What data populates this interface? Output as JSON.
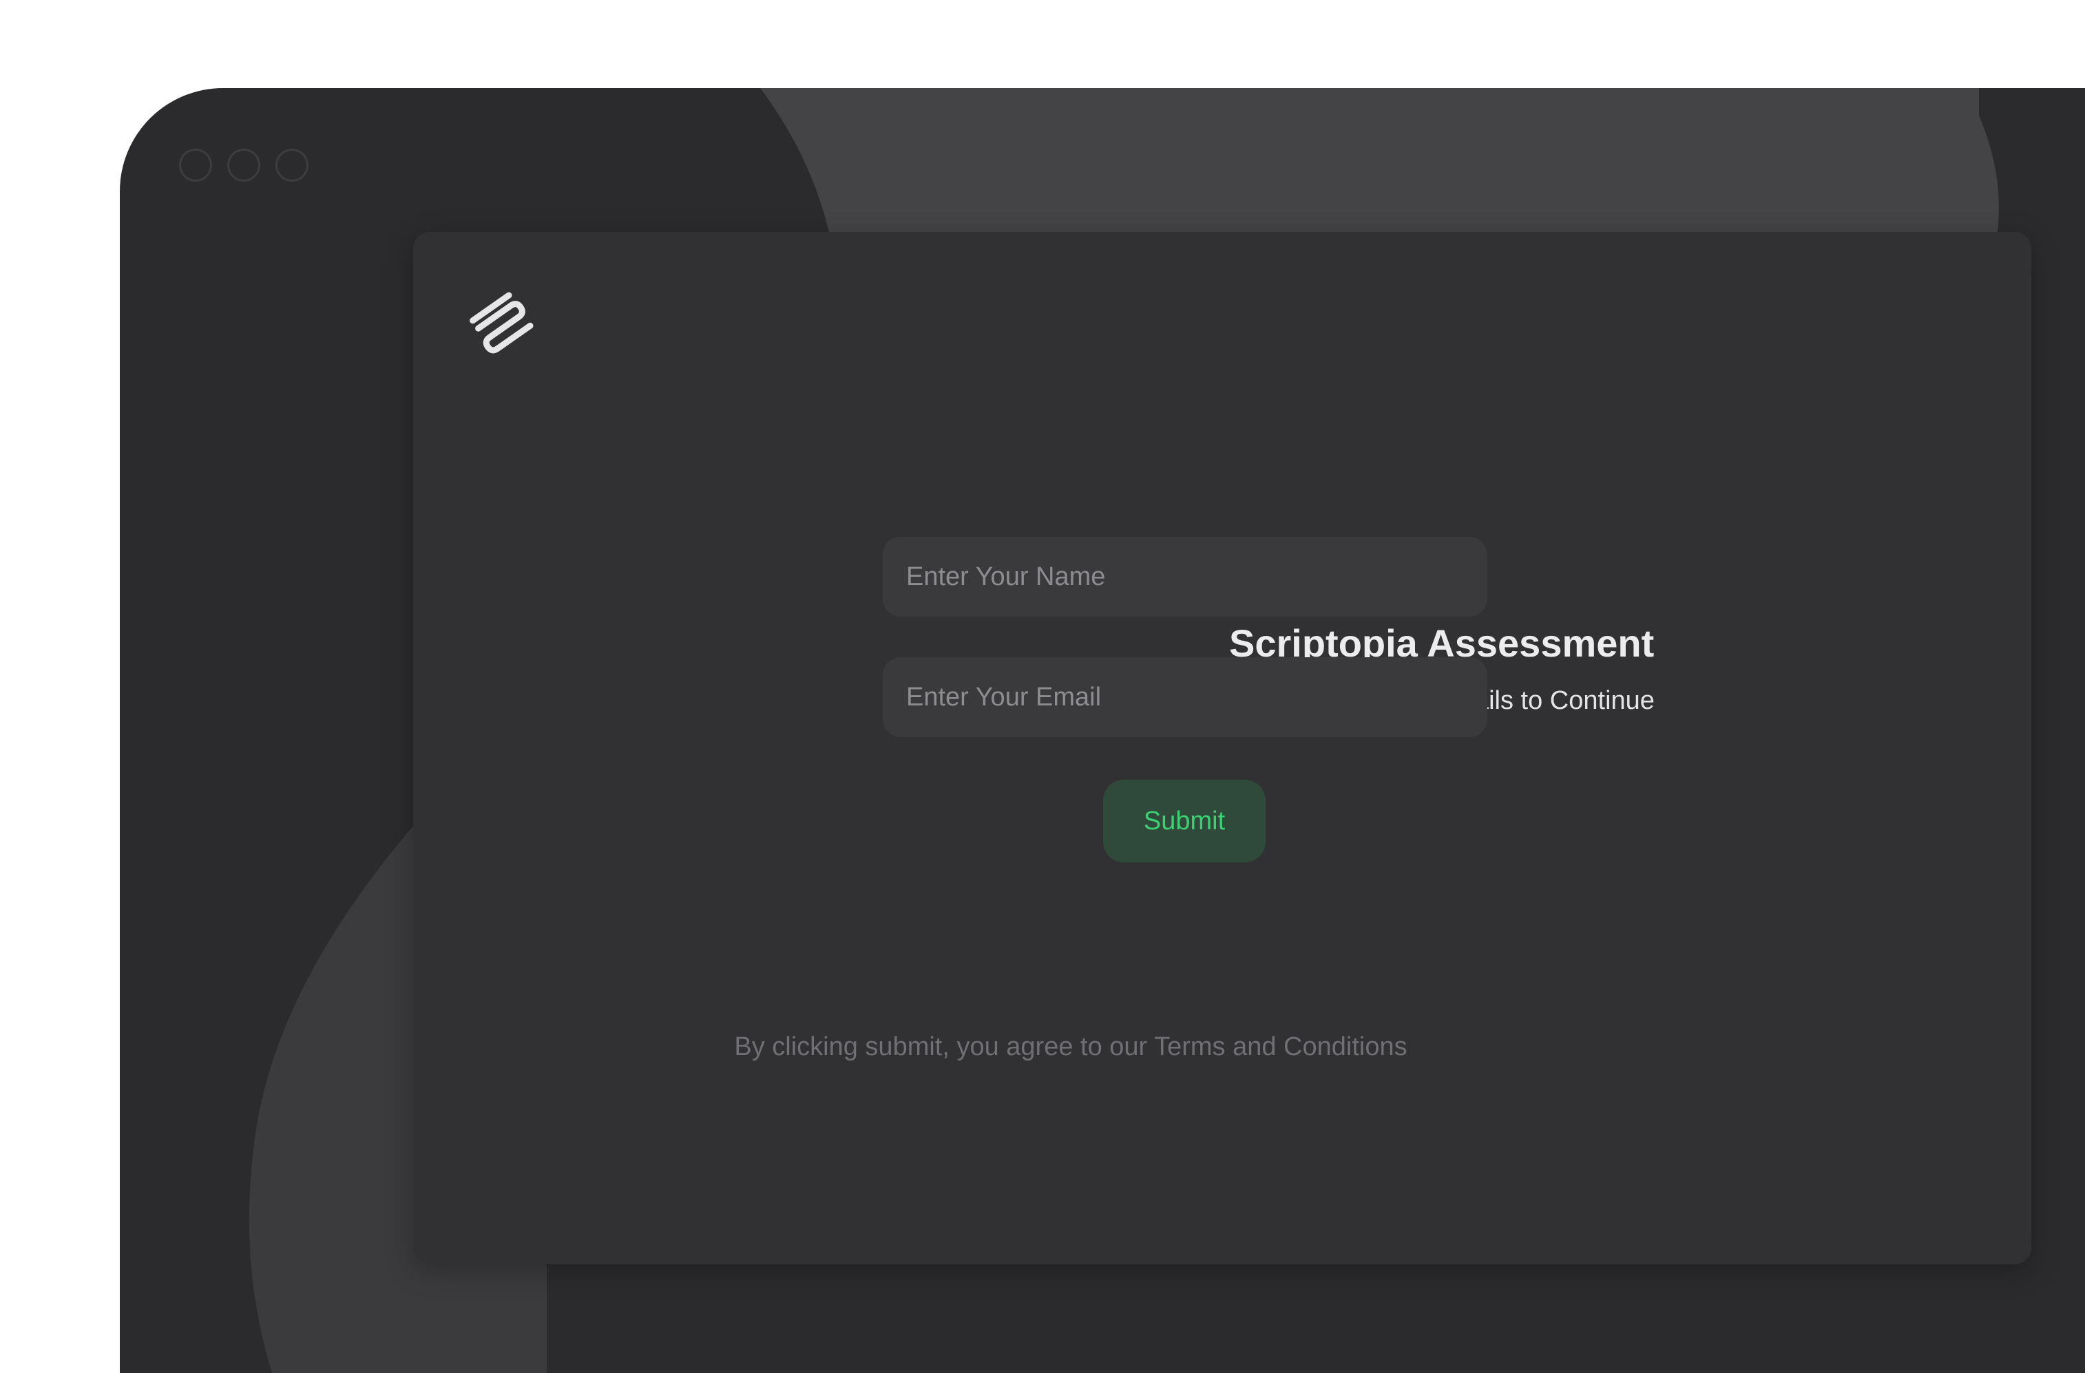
{
  "window": {
    "traffic_lights": [
      "close",
      "minimize",
      "maximize"
    ]
  },
  "logo": {
    "icon": "scriptopia-logo-icon"
  },
  "form": {
    "title": "Scriptopia Assessment",
    "subtitle": "Please Enter Your Details to Continue",
    "name_placeholder": "Enter Your Name",
    "name_value": "",
    "email_placeholder": "Enter Your Email",
    "email_value": "",
    "submit_label": "Submit"
  },
  "footer": {
    "terms": "By clicking submit, you agree to our Terms and Conditions"
  },
  "colors": {
    "window_bg": "#2b2b2d",
    "card_bg": "#313133",
    "input_bg": "#3a3a3c",
    "accent": "#3dd072",
    "accent_bg": "#2f4a3b"
  }
}
